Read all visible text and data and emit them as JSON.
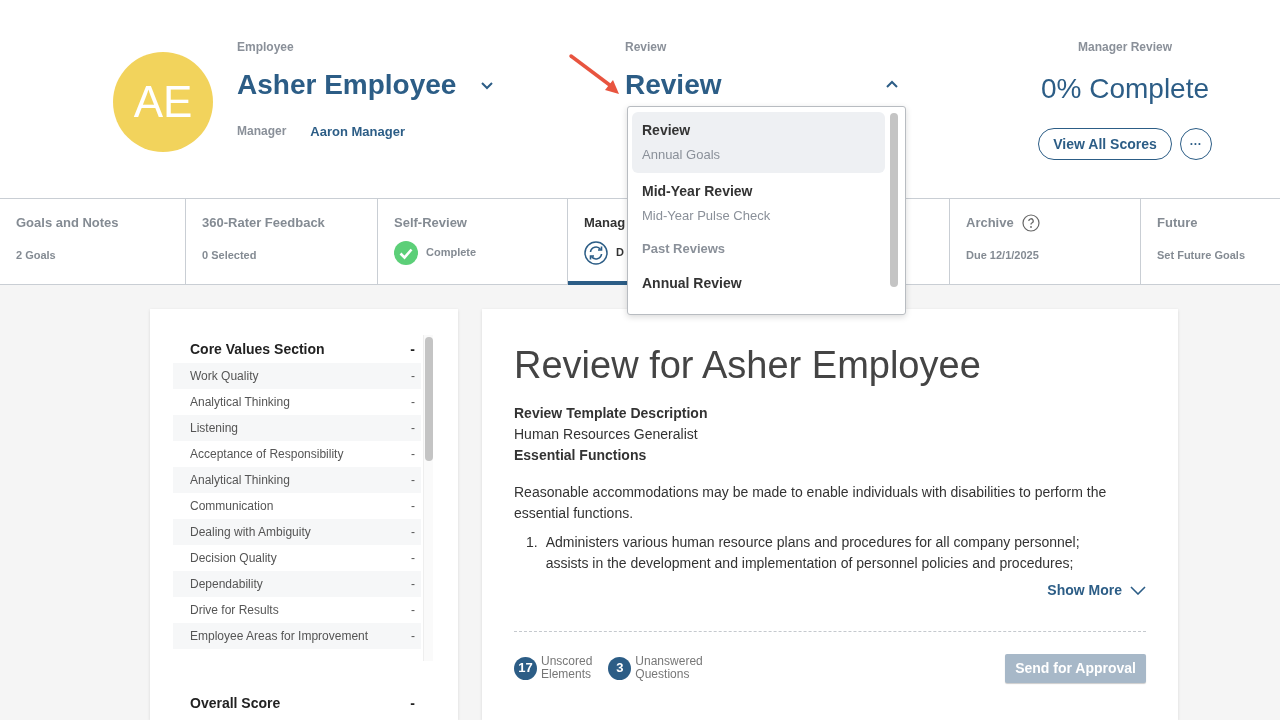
{
  "employee": {
    "label": "Employee",
    "initials": "AE",
    "name": "Asher Employee",
    "manager_label": "Manager",
    "manager": "Aaron Manager"
  },
  "review": {
    "label": "Review",
    "title": "Review",
    "expanded": true
  },
  "dropdown": {
    "items": [
      {
        "kind": "option",
        "title": "Review",
        "subtitle": "Annual Goals",
        "selected": true
      },
      {
        "kind": "option",
        "title": "Mid-Year Review",
        "subtitle": "Mid-Year Pulse Check",
        "selected": false
      },
      {
        "kind": "header",
        "title": "Past Reviews"
      },
      {
        "kind": "option",
        "title": "Annual Review",
        "selected": false
      }
    ]
  },
  "manager_review": {
    "label": "Manager Review",
    "progress": "0% Complete",
    "scores_button": "View All Scores",
    "more_button": "···"
  },
  "tabs": [
    {
      "title": "Goals and Notes",
      "status": "2 Goals",
      "kind": "plain",
      "help": false,
      "selected": false
    },
    {
      "title": "360-Rater Feedback",
      "status": "0 Selected",
      "kind": "plain",
      "help": false,
      "selected": false
    },
    {
      "title": "Self-Review",
      "status": "Complete",
      "kind": "done",
      "help": false,
      "selected": false
    },
    {
      "title": "Manag",
      "status": "D",
      "kind": "pending",
      "help": false,
      "selected": true
    },
    {
      "title": "Archive",
      "status": "Due 12/1/2025",
      "kind": "plain",
      "help": true,
      "selected": false
    },
    {
      "title": "Future",
      "status": "Set Future Goals",
      "kind": "plain",
      "help": false,
      "selected": false
    }
  ],
  "sidebar": {
    "section": "Core Values Section",
    "section_value": "-",
    "items": [
      {
        "label": "Work Quality",
        "value": "-"
      },
      {
        "label": "Analytical Thinking",
        "value": "-"
      },
      {
        "label": "Listening",
        "value": "-"
      },
      {
        "label": "Acceptance of Responsibility",
        "value": "-"
      },
      {
        "label": "Analytical Thinking",
        "value": "-"
      },
      {
        "label": "Communication",
        "value": "-"
      },
      {
        "label": "Dealing with Ambiguity",
        "value": "-"
      },
      {
        "label": "Decision Quality",
        "value": "-"
      },
      {
        "label": "Dependability",
        "value": "-"
      },
      {
        "label": "Drive for Results",
        "value": "-"
      },
      {
        "label": "Employee Areas for Improvement",
        "value": "-"
      }
    ],
    "overall_label": "Overall Score",
    "overall_value": "-"
  },
  "main": {
    "title": "Review for Asher Employee",
    "template_heading": "Review Template Description",
    "template": "Human Resources Generalist",
    "functions_heading": "Essential Functions",
    "paragraph": "Reasonable accommodations may be made to enable individuals with disabilities to perform the essential functions.",
    "list": [
      {
        "number": "1.",
        "text": "Administers various human resource plans and procedures for all company personnel; assists in the development and implementation of personnel policies and procedures;"
      }
    ],
    "show_more": "Show More",
    "counters": [
      {
        "count": "17",
        "lines": [
          "Unscored",
          "Elements"
        ]
      },
      {
        "count": "3",
        "lines": [
          "Unanswered",
          "Questions"
        ]
      }
    ],
    "send_button": {
      "label": "Send for Approval",
      "disabled": true
    }
  }
}
